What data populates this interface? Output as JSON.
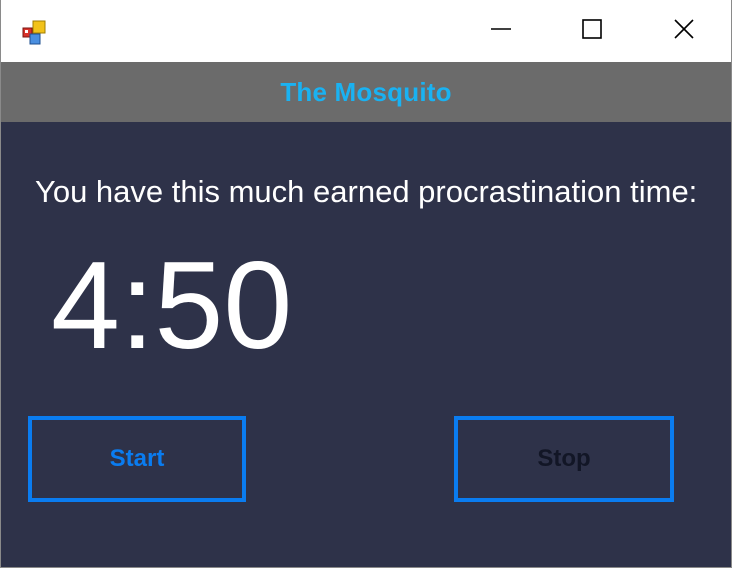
{
  "window": {
    "controls": {
      "minimize_icon": "minimize-icon",
      "maximize_icon": "maximize-icon",
      "close_icon": "close-icon"
    }
  },
  "header": {
    "title": "The Mosquito",
    "title_color": "#1ab2f2",
    "band_color": "#6b6b6b"
  },
  "main": {
    "prompt": "You have this much earned procrastination time:",
    "timer": "4:50",
    "background_color": "#2e3249"
  },
  "buttons": {
    "start_label": "Start",
    "stop_label": "Stop",
    "border_color": "#0a7cf0"
  }
}
